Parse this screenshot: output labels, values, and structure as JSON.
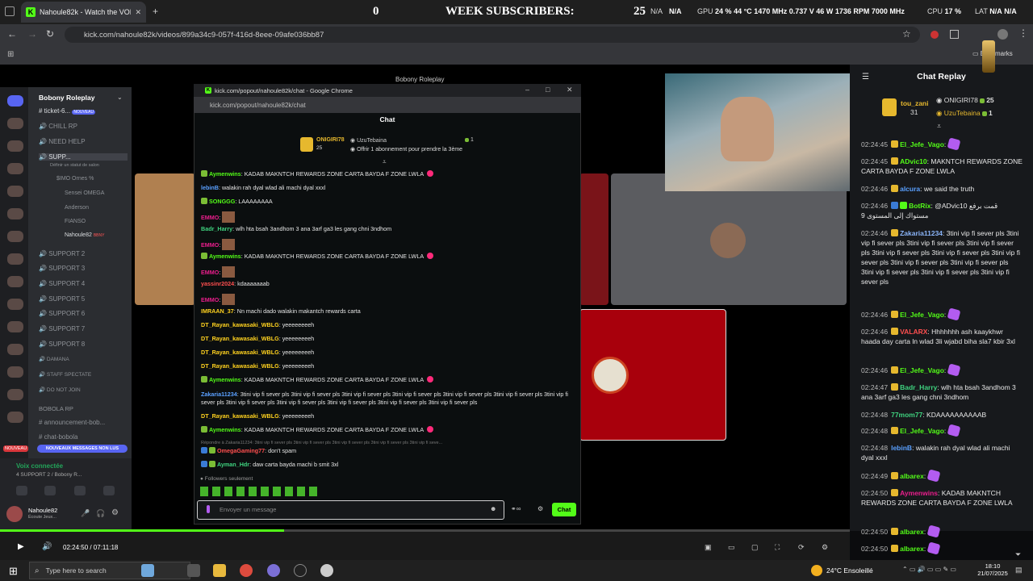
{
  "browser": {
    "tab_title": "Nahoule82k - Watch the VOD ...",
    "url": "kick.com/nahoule82k/videos/899a34c9-057f-416d-8eee-09afe036bb87",
    "bookmarks_label": "Bookmarks"
  },
  "overlay": {
    "left_count": "0",
    "week_subs_label": "WEEK SUBSCRIBERS:",
    "week_subs_value": "25",
    "na1": "N/A",
    "na2": "N/A",
    "gpu_label": "GPU",
    "gpu_pct": "24 %",
    "gpu_temp": "44 °C",
    "gpu_clock": "1470 MHz",
    "gpu_volt": "0.737 V",
    "gpu_watt": "46 W",
    "gpu_rpm": "1736 RPM",
    "mem_clock": "7000 MHz",
    "cpu_label": "CPU",
    "cpu_pct": "17 %",
    "lat_label": "LAT",
    "lat_na1": "N/A",
    "lat_na2": "N/A"
  },
  "discord": {
    "server_name": "Bobony Roleplay",
    "stream_title": "Bobony Roleplay",
    "channels": [
      {
        "label": "ticket-6...",
        "badge": "NOUVEAU"
      },
      {
        "label": "CHILL RP"
      },
      {
        "label": "NEED HELP"
      },
      {
        "label": "SUPP..."
      },
      {
        "label": "Définir un statut de salon"
      },
      {
        "label": "$IMO Ornes %"
      },
      {
        "label": "Sensei OMEGA"
      },
      {
        "label": "Anderson"
      },
      {
        "label": "FIANSO"
      },
      {
        "label": "Nahoule82",
        "badge": "BBNY"
      },
      {
        "label": "SUPPORT 2"
      },
      {
        "label": "SUPPORT 3"
      },
      {
        "label": "SUPPORT 4"
      },
      {
        "label": "SUPPORT 5"
      },
      {
        "label": "SUPPORT 6"
      },
      {
        "label": "SUPPORT 7"
      },
      {
        "label": "SUPPORT 8"
      },
      {
        "label": "DAMANA"
      },
      {
        "label": "STAFF SPECTATE"
      },
      {
        "label": "DO NOT JOIN"
      },
      {
        "label": "BOBOLA RP"
      },
      {
        "label": "announcement-bob..."
      },
      {
        "label": "chat-bobola"
      }
    ],
    "new_messages": "NOUVEAUX MESSAGES NON LUS",
    "voice_connected": "Voix connectée",
    "voice_channel": "4 SUPPORT 2 / Bobony R...",
    "user_name": "Nahoule82",
    "user_status": "Écoute Jeux..."
  },
  "popup": {
    "window_title": "kick.com/popout/nahoule82k/chat - Google Chrome",
    "url": "kick.com/popout/nahoule82k/chat",
    "header": "Chat",
    "top_gifter": "ONIGIRI78",
    "top_gifter_count": "25",
    "second_gifter": "UzuTebaina",
    "second_gifter_count": "1",
    "gift_text": "Offrir 1 abonnement pour prendre la 3ème",
    "followers_only": "Followers seulement",
    "input_placeholder": "Envoyer un message",
    "send_label": "Chat",
    "reply_hint": "Répondre à Zakaria11234: 3tini vip fi sever pls 3tini vip fi sever pls 3tini vip fi sever pls 3tini vip fi sever pls 3tini vip fi seve...",
    "messages": [
      {
        "user": "Aymenwins",
        "text": "KADAB MAKNTCH REWARDS ZONE CARTA BAYDA F ZONE LWLA"
      },
      {
        "user": "lebinB",
        "text": "walakin rah dyal wlad ali machi dyal xxxl"
      },
      {
        "user": "SONGGG",
        "text": "LAAAAAAAA"
      },
      {
        "user": "EMMO",
        "text": ""
      },
      {
        "user": "Badr_Harry",
        "text": "wlh hta bsah 3andhom 3 ana 3arf ga3 les gang chni 3ndhom"
      },
      {
        "user": "EMMO",
        "text": ""
      },
      {
        "user": "Aymenwins",
        "text": "KADAB MAKNTCH REWARDS ZONE CARTA BAYDA F ZONE LWLA"
      },
      {
        "user": "EMMO",
        "text": ""
      },
      {
        "user": "yassinr2024",
        "text": "kdaaaaaaab"
      },
      {
        "user": "EMMO",
        "text": ""
      },
      {
        "user": "IMRAAN_37",
        "text": "Nn machi dado walakin makantch rewards carta"
      },
      {
        "user": "DT_Rayan_kawasaki_WBLG",
        "text": "yeeeeeeeeh"
      },
      {
        "user": "DT_Rayan_kawasaki_WBLG",
        "text": "yeeeeeeeeh"
      },
      {
        "user": "DT_Rayan_kawasaki_WBLG",
        "text": "yeeeeeeeeh"
      },
      {
        "user": "DT_Rayan_kawasaki_WBLG",
        "text": "yeeeeeeeeh"
      },
      {
        "user": "Aymenwins",
        "text": "KADAB MAKNTCH REWARDS ZONE CARTA BAYDA F ZONE LWLA"
      },
      {
        "user": "Zakaria11234",
        "text": "3tini vip fi sever pls 3tini vip fi sever pls 3tini vip fi sever pls 3tini vip fi sever pls 3tini vip fi sever pls 3tini vip fi sever pls 3tini vip fi sever pls 3tini vip fi sever pls 3tini vip fi sever pls 3tini vip fi sever pls 3tini vip fi sever pls 3tini vip fi sever pls"
      },
      {
        "user": "DT_Rayan_kawasaki_WBLG",
        "text": "yeeeeeeeeh"
      },
      {
        "user": "Aymenwins",
        "text": "KADAB MAKNTCH REWARDS ZONE CARTA BAYDA F ZONE LWLA"
      },
      {
        "user": "OmegaGaming77",
        "text": "don't spam"
      },
      {
        "user": "Ayman_Hdr",
        "text": "daw carta bayda machi b smit 3xl"
      }
    ]
  },
  "replay": {
    "title": "Chat Replay",
    "gifter1": "tou_zani",
    "gifter1_count": "31",
    "gifter2": "ONIGIRI78",
    "gifter2_count": "25",
    "gifter3": "UzuTebaina",
    "gifter3_count": "1",
    "messages": [
      {
        "time": "02:24:45",
        "user": "El_Jefe_Vago",
        "text": ""
      },
      {
        "time": "02:24:45",
        "user": "ADvic10",
        "text": "MAKNTCH REWARDS ZONE CARTA BAYDA F ZONE LWLA"
      },
      {
        "time": "02:24:46",
        "user": "alcura",
        "text": "we said the truth"
      },
      {
        "time": "02:24:46",
        "user": "BotRix",
        "text": "@ADvic10 قمت برفع مستواك إلى المستوى 9"
      },
      {
        "time": "02:24:46",
        "user": "Zakaria11234",
        "text": "3tini vip fi sever pls 3tini vip fi sever pls 3tini vip fi sever pls 3tini vip fi sever pls 3tini vip fi sever pls 3tini vip fi sever pls 3tini vip fi sever pls 3tini vip fi sever pls 3tini vip fi sever pls 3tini vip fi sever pls 3tini vip fi sever pls 3tini vip fi sever pls"
      },
      {
        "time": "02:24:46",
        "user": "El_Jefe_Vago",
        "text": ""
      },
      {
        "time": "02:24:46",
        "user": "VALARX",
        "text": "Hhhhhhh ash kaaykhwr haada day carta ln wlad 3li wjabd biha sla7 kbir 3xl"
      },
      {
        "time": "02:24:46",
        "user": "El_Jefe_Vago",
        "text": ""
      },
      {
        "time": "02:24:47",
        "user": "Badr_Harry",
        "text": "wlh hta bsah 3andhom 3 ana 3arf ga3 les gang chni 3ndhom"
      },
      {
        "time": "02:24:48",
        "user": "77mom77",
        "text": "KDAAAAAAAAAAB"
      },
      {
        "time": "02:24:48",
        "user": "El_Jefe_Vago",
        "text": ""
      },
      {
        "time": "02:24:48",
        "user": "lebinB",
        "text": "walakin rah dyal wlad ali machi dyal xxxl"
      },
      {
        "time": "02:24:49",
        "user": "albarex",
        "text": ""
      },
      {
        "time": "02:24:50",
        "user": "Aymenwins",
        "text": "KADAB MAKNTCH REWARDS ZONE CARTA BAYDA F ZONE LWLA"
      },
      {
        "time": "02:24:50",
        "user": "albarex",
        "text": ""
      },
      {
        "time": "02:24:50",
        "user": "albarex",
        "text": ""
      }
    ]
  },
  "player": {
    "time": "02:24:50 / 07:11:18"
  },
  "taskbar": {
    "search_placeholder": "Type here to search",
    "weather": "24°C Ensoleillé",
    "clock_time": "18:10",
    "clock_date": "21/07/2025"
  },
  "colors": {
    "kick_green": "#53fc18",
    "accent_red": "#a8000c"
  }
}
